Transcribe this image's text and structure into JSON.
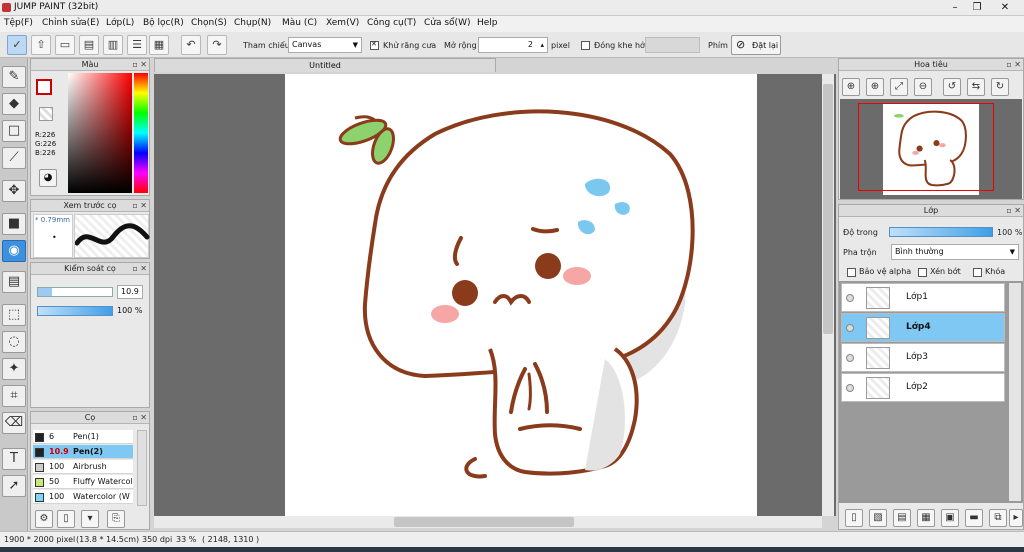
{
  "window": {
    "title": "JUMP PAINT (32bit)"
  },
  "menu": [
    "Tệp(F)",
    "Chỉnh sửa(E)",
    "Lớp(L)",
    "Bộ lọc(R)",
    "Chọn(S)",
    "Chụp(N)",
    "Màu (C)",
    "Xem(V)",
    "Công cụ(T)",
    "Cửa sổ(W)",
    "Help"
  ],
  "toolbar": {
    "reference_label": "Tham chiếu",
    "reference_value": "Canvas",
    "antialias_label": "Khử răng cưa",
    "expand_label": "Mở rộng",
    "expand_value": "2",
    "expand_unit": "pixel",
    "close_gap_label": "Đóng khe hở",
    "key_label": "Phím",
    "reset_label": "Đặt lại"
  },
  "color_panel": {
    "title": "Màu",
    "r": "R:226",
    "g": "G:226",
    "b": "B:226"
  },
  "preview_panel": {
    "title": "Xem trước cọ",
    "size": "0.79mm"
  },
  "brush_control": {
    "title": "Kiểm soát cọ",
    "size_value": "10.9",
    "opacity_value": "100 %"
  },
  "brush_panel": {
    "title": "Cọ",
    "brushes": [
      {
        "size": "6",
        "name": "Pen(1)",
        "color": "#222222"
      },
      {
        "size": "10.9",
        "name": "Pen(2)",
        "color": "#222222"
      },
      {
        "size": "100",
        "name": "Airbrush",
        "color": "#cccccc"
      },
      {
        "size": "50",
        "name": "Fluffy Watercol",
        "color": "#c8e87a"
      },
      {
        "size": "100",
        "name": "Watercolor (W",
        "color": "#7fd6f2"
      }
    ]
  },
  "document": {
    "tab_title": "Untitled"
  },
  "navigator": {
    "title": "Hoa tiêu"
  },
  "layer_panel": {
    "title": "Lớp",
    "opacity_label": "Độ trong",
    "opacity_value": "100 %",
    "blend_label": "Pha trộn",
    "blend_value": "Bình thường",
    "protect_alpha_label": "Bảo vệ alpha",
    "clip_label": "Xén bớt",
    "lock_label": "Khóa",
    "layers": [
      {
        "name": "Lớp1",
        "selected": false
      },
      {
        "name": "Lớp4",
        "selected": true
      },
      {
        "name": "Lớp3",
        "selected": false
      },
      {
        "name": "Lớp2",
        "selected": false
      }
    ]
  },
  "status": {
    "canvas_size": "1900 * 2000 pixel",
    "physical_size": "(13.8 * 14.5cm)",
    "dpi": "350 dpi",
    "zoom": "33 %",
    "cursor": "( 2148, 1310 )"
  },
  "colors": {
    "accent_blue": "#3d8fe0",
    "selected_layer": "#7ec8f3",
    "stroke_brown": "#8a3b1c",
    "leaf_green": "#8ed26d"
  }
}
